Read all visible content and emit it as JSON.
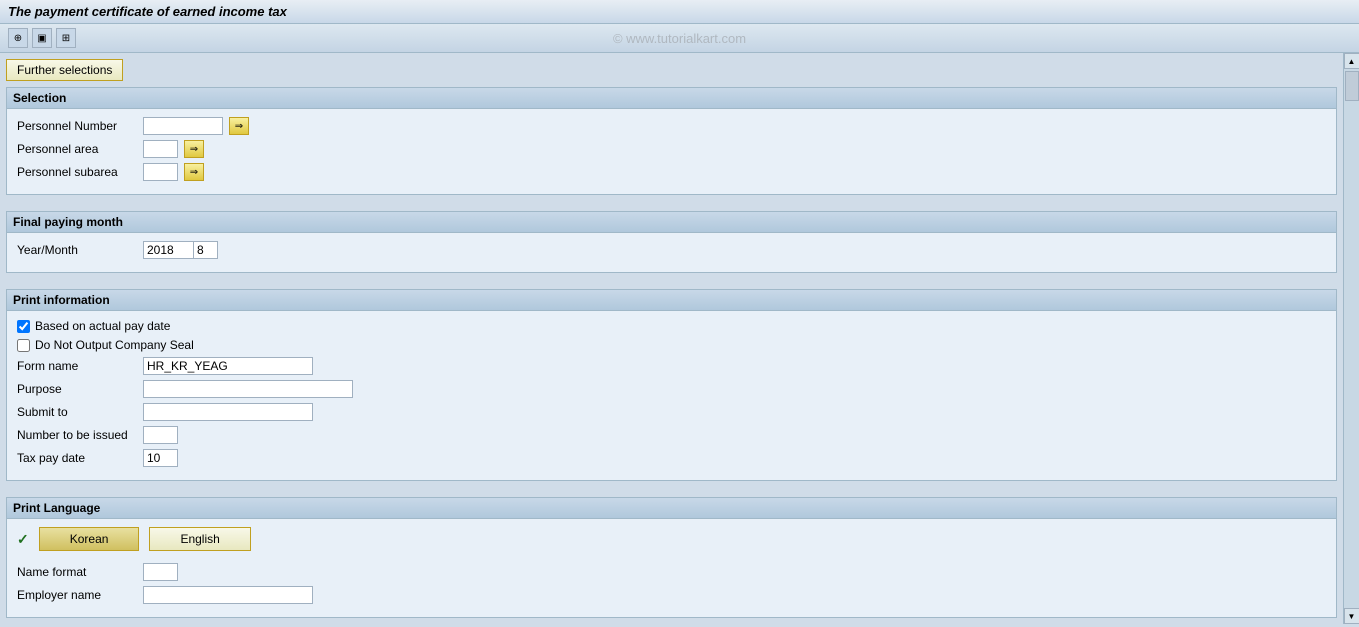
{
  "title": "The payment certificate of earned income tax",
  "watermark": "© www.tutorialkart.com",
  "toolbar": {
    "icons": [
      "clock-icon",
      "save-icon",
      "print-icon"
    ]
  },
  "further_selections_button": "Further selections",
  "sections": {
    "selection": {
      "header": "Selection",
      "fields": {
        "personnel_number": {
          "label": "Personnel Number",
          "value": ""
        },
        "personnel_area": {
          "label": "Personnel area",
          "value": ""
        },
        "personnel_subarea": {
          "label": "Personnel subarea",
          "value": ""
        }
      }
    },
    "final_paying_month": {
      "header": "Final paying month",
      "year_month_label": "Year/Month",
      "year_value": "2018",
      "month_value": "8"
    },
    "print_information": {
      "header": "Print information",
      "based_on_actual_pay_date_label": "Based on actual pay date",
      "based_on_actual_pay_date_checked": true,
      "do_not_output_label": "Do Not Output Company Seal",
      "do_not_output_checked": false,
      "form_name_label": "Form name",
      "form_name_value": "HR_KR_YEAG",
      "purpose_label": "Purpose",
      "purpose_value": "",
      "submit_to_label": "Submit to",
      "submit_to_value": "",
      "number_to_be_issued_label": "Number to be issued",
      "number_to_be_issued_value": "",
      "tax_pay_date_label": "Tax pay date",
      "tax_pay_date_value": "10"
    },
    "print_language": {
      "header": "Print Language",
      "korean_label": "Korean",
      "english_label": "English",
      "name_format_label": "Name format",
      "name_format_value": "",
      "employer_name_label": "Employer name",
      "employer_name_value": ""
    }
  }
}
